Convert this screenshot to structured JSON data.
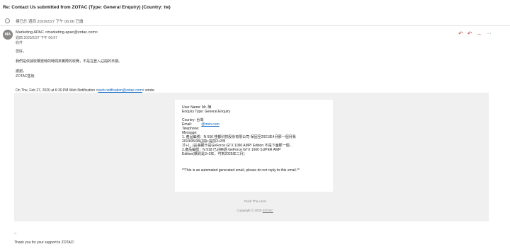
{
  "message": {
    "subject": "Re: Contact Us submitted from ZOTAC (Type: General Enquiry) (Country: tw)",
    "read_status": "標已於 週四 2020/2/27 下午 06:06 已讀"
  },
  "sender": {
    "initials": "MA",
    "display": "Marketing APAC <marketing.apac@zotac.com>",
    "sent": "週四 2020/2/27 下午 06:57",
    "to": "收件"
  },
  "actions": {
    "reply": "↶",
    "reply_all": "↶",
    "forward": "→",
    "more": "···"
  },
  "body": {
    "greeting": "您好，",
    "line1": "我們是依據收購當時的時間來實際的收費，不是在登入註冊的日期。",
    "sign1": "謝謝，",
    "sign2": "ZOTAC售後",
    "quote_prefix": "On Thu, Feb 27, 2020 at 6:30 PM Web Notification <",
    "quote_email": "web.notification@zotac.com",
    "quote_suffix": "> wrote:",
    "closing_dash": "--",
    "closing_thanks": "Thank you for your support to ZOTAC!"
  },
  "form": {
    "user_name": "User Name: Mr.         陳",
    "enquiry_type": "Enquiry Type: General Enquiry",
    "country": "Country: 台灣",
    "email_label": "Email: ",
    "email_value": "@msn.com",
    "telephone": "Telephone: ",
    "message_label": "Message:",
    "msg1": "1. 產品編號：N          556 桂都科技股份有限公司 保固至2021年4月那一個月我",
    "msg2": "2019/05/08註冊+提前3+2年",
    "msg3": "才+1...(註冊顯卡是GeForce GTX 1060 AMP! Edition 不是下面那一個...",
    "msg4": "2.產品編號：N         918 已註冊過 GeForce GTX 1660 SUPER AMP",
    "msg5": "Edition(購買是3+2年，可到2025年二月)",
    "notice": "**This is an automated generated email, please do not reply to this email.**"
  },
  "footer": {
    "push": "Push The Limit",
    "copyright_prefix": "Copyright © 2020 ",
    "copyright_link": "ZOTAC"
  }
}
